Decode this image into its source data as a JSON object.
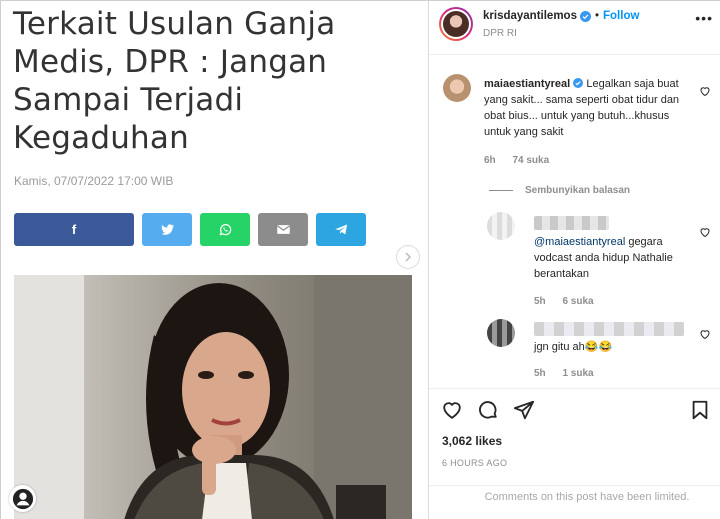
{
  "article": {
    "title_lines": [
      "Terkait Usulan Ganja",
      "Medis, DPR : Jangan",
      "Sampai Terjadi",
      "Kegaduhan"
    ],
    "date": "Kamis, 07/07/2022 17:00 WIB",
    "share_buttons": [
      {
        "name": "facebook",
        "glyph": "f",
        "color": "#3b5998"
      },
      {
        "name": "twitter",
        "glyph": "",
        "color": "#55acee"
      },
      {
        "name": "whatsapp",
        "glyph": "",
        "color": "#25d366"
      },
      {
        "name": "email",
        "glyph": "",
        "color": "#8c8c8c"
      },
      {
        "name": "telegram",
        "glyph": "",
        "color": "#2ca5e0"
      }
    ],
    "next_arrow_icon": "chevron-right-icon"
  },
  "post": {
    "username": "krisdayantilemos",
    "follow_label": "Follow",
    "location": "DPR RI",
    "separator": "•",
    "more_icon": "•••"
  },
  "comments": [
    {
      "username": "maiaestiantyreal",
      "text": "Legalkan saja buat yang sakit... sama seperti obat tidur dan obat bius... untuk yang butuh...khusus untuk yang sakit",
      "time": "6h",
      "likes": "74 suka"
    }
  ],
  "hide_replies_label": "Sembunyikan balasan",
  "replies": [
    {
      "mention": "@maiaestiantyreal",
      "text": " gegara vodcast anda hidup Nathalie berantakan",
      "time": "5h",
      "likes": "6 suka"
    },
    {
      "mention": "",
      "text": "jgn gitu ah😂😂",
      "time": "5h",
      "likes": "1 suka"
    }
  ],
  "engagement": {
    "likes_count": "3,062 likes",
    "time_ago": "6 HOURS AGO",
    "comments_limited": "Comments on this post have been limited."
  },
  "colors": {
    "accent": "#0095f6",
    "text": "#262626",
    "muted": "#8e8e8e"
  }
}
